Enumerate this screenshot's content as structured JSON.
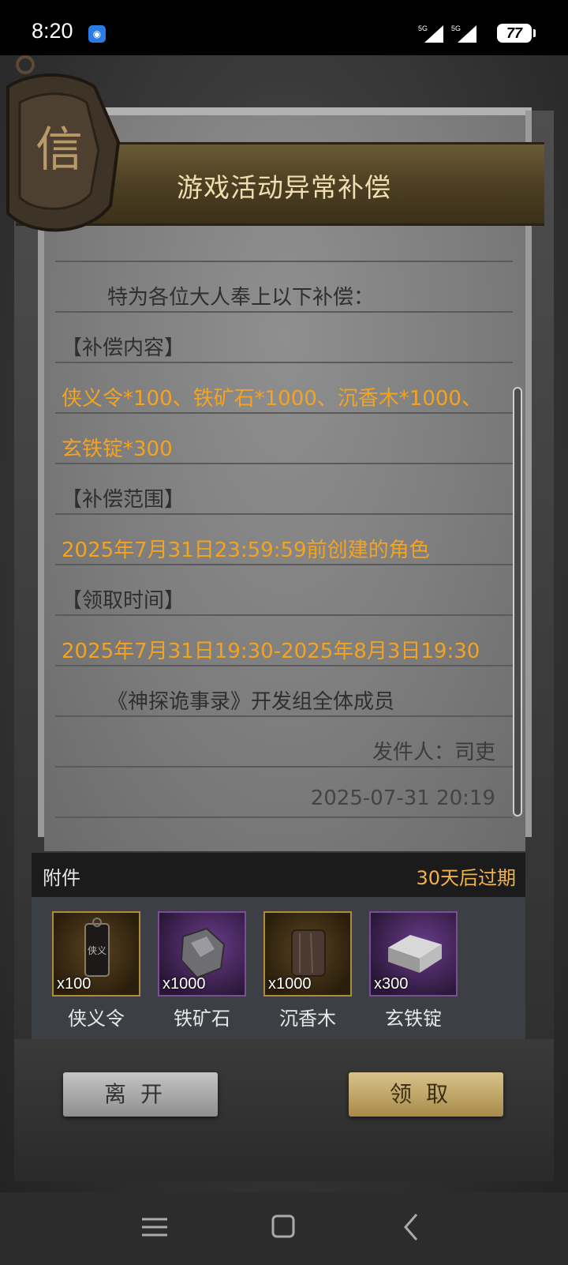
{
  "status_bar": {
    "time": "8:20",
    "network_1": "5G",
    "network_2": "5G",
    "battery": "77"
  },
  "mail": {
    "title": "游戏活动异常补偿",
    "medallion_char": "信",
    "intro": "特为各位大人奉上以下补偿：",
    "section_content": "【补偿内容】",
    "content_line1": "侠义令*100、铁矿石*1000、沉香木*1000、",
    "content_line2": "玄铁锭*300",
    "section_scope": "【补偿范围】",
    "scope_text": "2025年7月31日23:59:59前创建的角色",
    "section_time": "【领取时间】",
    "time_text": "2025年7月31日19:30-2025年8月3日19:30",
    "signature": "《神探诡事录》开发组全体成员",
    "sender": "发件人：司吏",
    "date": "2025-07-31 20:19"
  },
  "attachments": {
    "label": "附件",
    "expire": "30天后过期",
    "items": [
      {
        "name": "侠义令",
        "qty": "x100",
        "icon": "token-icon",
        "frame": "gold"
      },
      {
        "name": "铁矿石",
        "qty": "x1000",
        "icon": "iron-ore-icon",
        "frame": "purple"
      },
      {
        "name": "沉香木",
        "qty": "x1000",
        "icon": "agarwood-icon",
        "frame": "gold"
      },
      {
        "name": "玄铁锭",
        "qty": "x300",
        "icon": "iron-ingot-icon",
        "frame": "purple"
      }
    ]
  },
  "buttons": {
    "leave": "离开",
    "claim": "领取"
  },
  "colors": {
    "highlight": "#f4a320",
    "title": "#f1deb0",
    "expire": "#f1b24a"
  }
}
